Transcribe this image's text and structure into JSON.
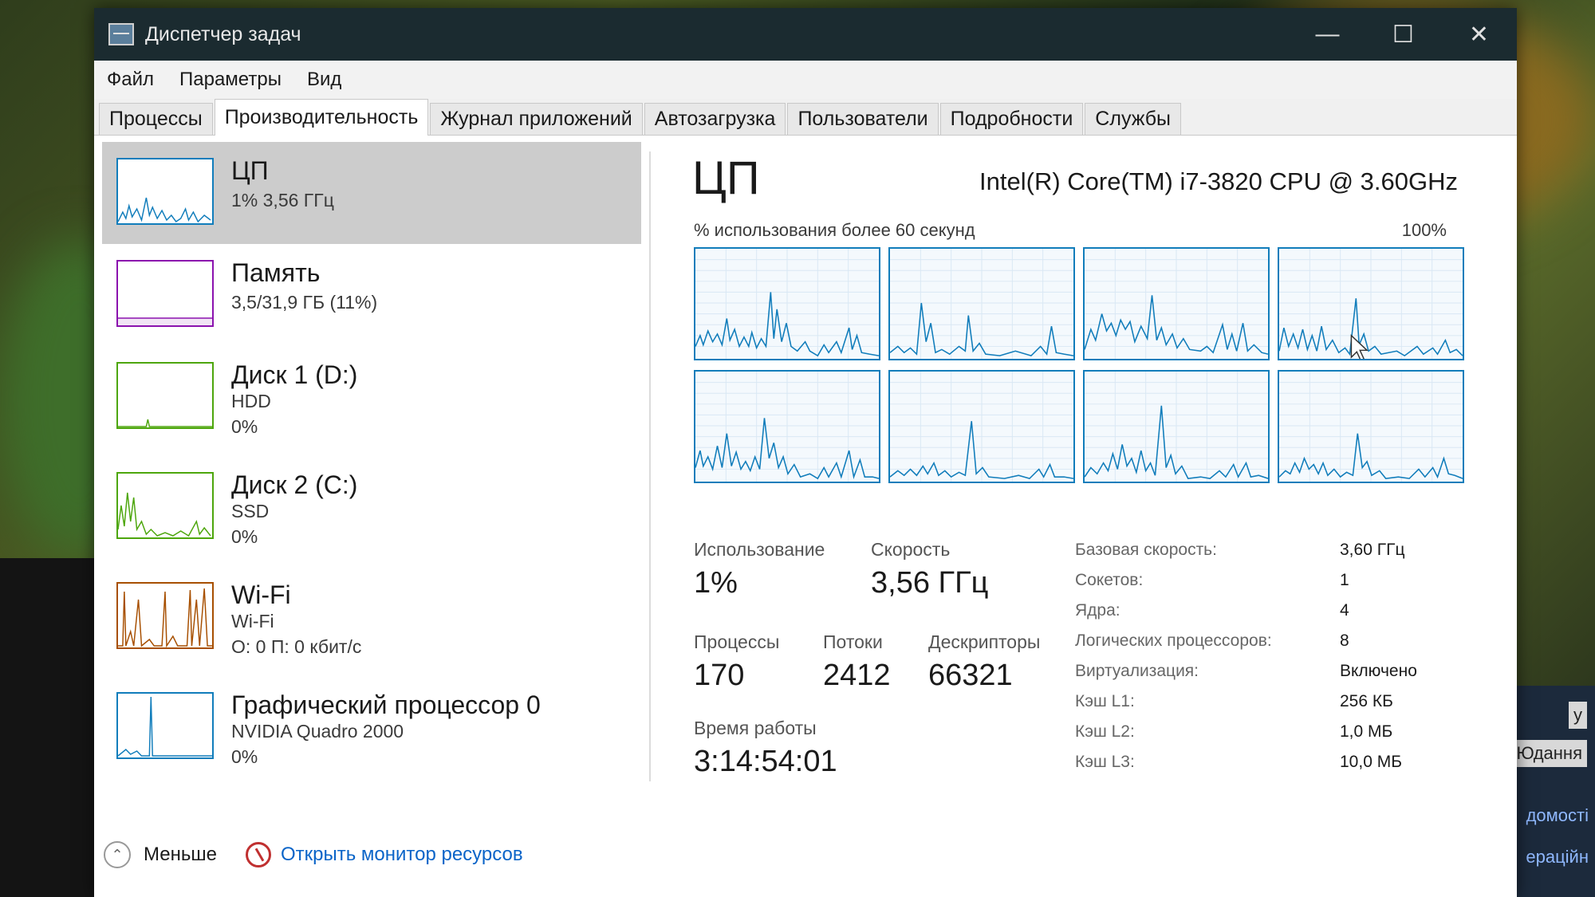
{
  "window": {
    "title": "Диспетчер задач",
    "controls": {
      "minimize": "—",
      "maximize": "☐",
      "close": "✕"
    }
  },
  "menu": [
    "Файл",
    "Параметры",
    "Вид"
  ],
  "tabs": [
    "Процессы",
    "Производительность",
    "Журнал приложений",
    "Автозагрузка",
    "Пользователи",
    "Подробности",
    "Службы"
  ],
  "active_tab": "Производительность",
  "sidebar": [
    {
      "name": "ЦП",
      "lines": [
        "1% 3,56 ГГц"
      ],
      "color": "#117dbb"
    },
    {
      "name": "Память",
      "lines": [
        "3,5/31,9 ГБ (11%)"
      ],
      "color": "#8b12ae"
    },
    {
      "name": "Диск 1 (D:)",
      "lines": [
        "HDD",
        "0%"
      ],
      "color": "#4da60c"
    },
    {
      "name": "Диск 2 (C:)",
      "lines": [
        "SSD",
        "0%"
      ],
      "color": "#4da60c"
    },
    {
      "name": "Wi-Fi",
      "lines": [
        "Wi-Fi",
        "О: 0 П: 0 кбит/с"
      ],
      "color": "#a74f01"
    },
    {
      "name": "Графический процессор 0",
      "lines": [
        "NVIDIA Quadro 2000",
        "0%"
      ],
      "color": "#117dbb"
    }
  ],
  "main": {
    "title": "ЦП",
    "model": "Intel(R) Core(TM) i7-3820 CPU @ 3.60GHz",
    "graph_caption": "% использования более 60 секунд",
    "graph_max": "100%",
    "stats": {
      "usage_label": "Использование",
      "usage_value": "1%",
      "speed_label": "Скорость",
      "speed_value": "3,56 ГГц",
      "processes_label": "Процессы",
      "processes_value": "170",
      "threads_label": "Потоки",
      "threads_value": "2412",
      "handles_label": "Дескрипторы",
      "handles_value": "66321",
      "uptime_label": "Время работы",
      "uptime_value": "3:14:54:01"
    },
    "specs": [
      {
        "key": "Базовая скорость:",
        "value": "3,60 ГГц"
      },
      {
        "key": "Сокетов:",
        "value": "1"
      },
      {
        "key": "Ядра:",
        "value": "4"
      },
      {
        "key": "Логических процессоров:",
        "value": "8"
      },
      {
        "key": "Виртуализация:",
        "value": "Включено"
      },
      {
        "key": "Кэш L1:",
        "value": "256 КБ"
      },
      {
        "key": "Кэш L2:",
        "value": "1,0 МБ"
      },
      {
        "key": "Кэш L3:",
        "value": "10,0 МБ"
      }
    ]
  },
  "footer": {
    "less": "Меньше",
    "monitor_link": "Открыть монитор ресурсов"
  },
  "background_text": [
    "у",
    "Юдання",
    "домості",
    "ераційн"
  ]
}
